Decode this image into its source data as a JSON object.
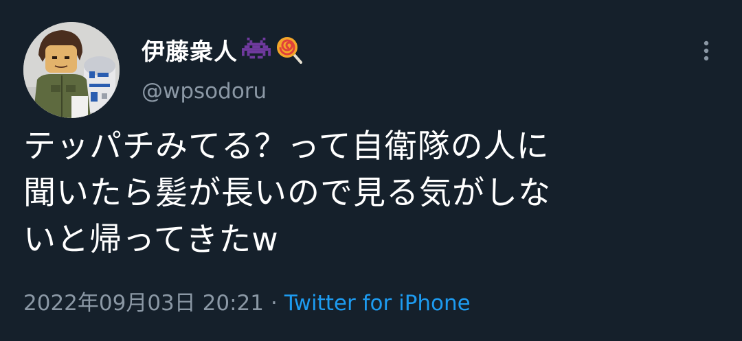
{
  "user": {
    "display_name": "伊藤衆人",
    "badge_icons": [
      "space-invader-icon",
      "lollipop-icon"
    ],
    "handle": "@wpsodoru"
  },
  "tweet": {
    "text": "テッパチみてる？って自衛隊の人に\n聞いたら髪が長いので見る気がしな\nいと帰ってきたw",
    "timestamp": "2022年09月03日 20:21",
    "separator": "·",
    "source": "Twitter for iPhone"
  },
  "colors": {
    "background": "#15202b",
    "primary_text": "#ffffff",
    "secondary_text": "#8b98a5",
    "link": "#1d9bf0"
  },
  "icons": {
    "avatar": "lego-figure-avatar",
    "more": "more-vertical-icon"
  }
}
